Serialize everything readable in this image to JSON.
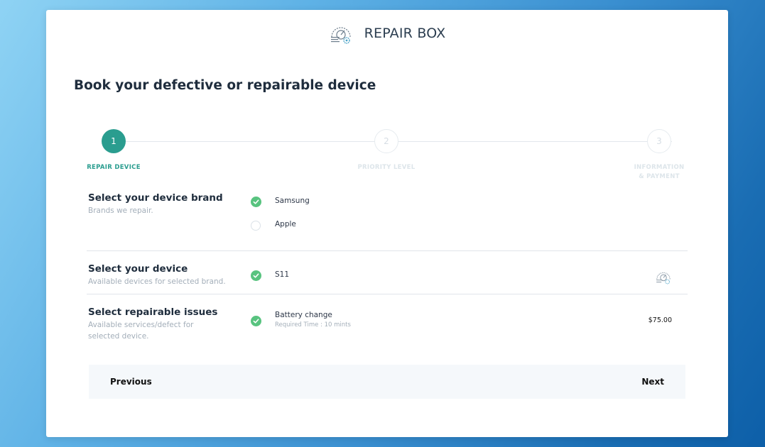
{
  "brand": {
    "name": "REPAIR BOX"
  },
  "page": {
    "title": "Book your defective or repairable device"
  },
  "stepper": {
    "steps": [
      {
        "number": "1",
        "label": "REPAIR DEVICE"
      },
      {
        "number": "2",
        "label": "PRIORITY LEVEL"
      },
      {
        "number": "3",
        "label": "INFORMATION & PAYMENT"
      }
    ]
  },
  "brand_section": {
    "title": "Select your device brand",
    "subtitle": "Brands we repair.",
    "options": [
      {
        "label": "Samsung",
        "selected": true
      },
      {
        "label": "Apple",
        "selected": false
      }
    ]
  },
  "device_section": {
    "title": "Select your device",
    "subtitle": "Available devices for selected brand.",
    "options": [
      {
        "label": "S11",
        "selected": true
      }
    ]
  },
  "issues_section": {
    "title": "Select repairable issues",
    "subtitle": "Available services/defect for selected device.",
    "options": [
      {
        "label": "Battery change",
        "detail": "Required Time : 10 mints",
        "price": "$75.00",
        "selected": true
      }
    ]
  },
  "footer": {
    "previous_label": "Previous",
    "next_label": "Next"
  },
  "colors": {
    "accent": "#2a9d8f",
    "check": "#58c37f"
  }
}
